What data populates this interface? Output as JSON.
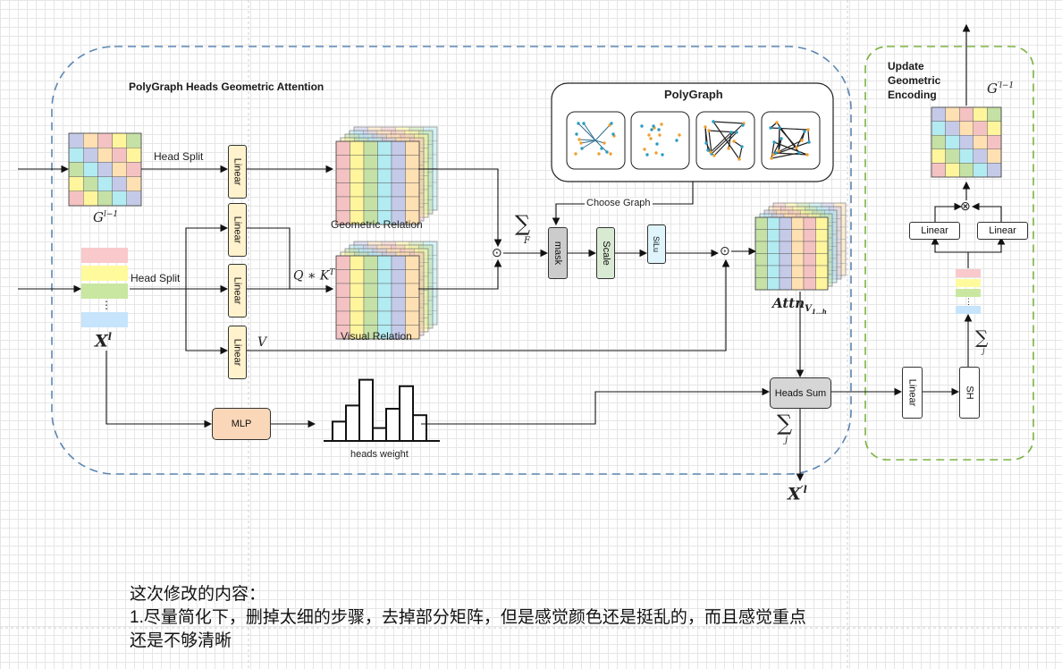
{
  "main_group": {
    "title": "PolyGraph Heads Geometric Attention"
  },
  "update_group": {
    "title_lines": [
      "Update",
      "Geometric",
      "Encoding"
    ]
  },
  "polygraph": {
    "title": "PolyGraph",
    "choose_graph": "Choose Graph"
  },
  "labels": {
    "head_split_top": "Head Split",
    "head_split_bottom": "Head Split",
    "geometric_relation": "Geometric Relation",
    "visual_relation": "Visual Relation",
    "heads_weight": "heads weight",
    "qk": "Q ∗ K",
    "qk_sup": "T",
    "v": "V",
    "g_in": "G",
    "g_in_sup": "l−1",
    "x_in": "X",
    "x_in_sup": "l",
    "attn": "Attn",
    "attn_sub": "V",
    "attn_subsub": "1…h",
    "x_out": "X",
    "x_out_sup": "′l",
    "g_out": "G",
    "g_out_sup": "′l−1",
    "sum_f_sym": "∑",
    "sum_f_sub": "F",
    "sum_j_sym": "∑",
    "sum_j_sub": "j",
    "sum_j2_sym": "∑",
    "sum_j2_sub": "j",
    "odot1": "⊙",
    "odot2": "⊙",
    "otimes": "⊗",
    "dots": "⋮",
    "dots2": "⋮"
  },
  "blocks": {
    "linear_1": "Linear",
    "linear_2": "Linear",
    "linear_3": "Linear",
    "linear_4": "Linear",
    "mask": "mask",
    "scale": "Scale",
    "silu": "SiLu",
    "mlp": "MLP",
    "heads_sum": "Heads Sum",
    "linear_5": "Linear",
    "sh": "SH",
    "linear_6": "Linear",
    "linear_7": "Linear"
  },
  "matrix_palette": [
    "#f4c2c2",
    "#fff59d",
    "#c5e1a5",
    "#b2ebf2",
    "#c5cae9",
    "#ffe0b2"
  ],
  "colors": {
    "main_border": "#5b86b3",
    "update_border": "#7cb342",
    "mask_fill": "#cccccc",
    "scale_fill": "#d9ead3",
    "silu_fill": "#dff5fb",
    "mlp_fill": "#fad7b8",
    "heads_sum_fill": "#d6d6d6",
    "linear_fill": "#fff2cc"
  },
  "heads_weight_values": [
    0.3,
    0.55,
    0.95,
    0.2,
    0.5,
    0.85,
    0.4
  ],
  "notes": {
    "line1": "这次修改的内容：",
    "line2": "1.尽量简化下，删掉太细的步骤，去掉部分矩阵，但是感觉颜色还是挺乱的，而且感觉重点",
    "line3": "还是不够清晰"
  }
}
